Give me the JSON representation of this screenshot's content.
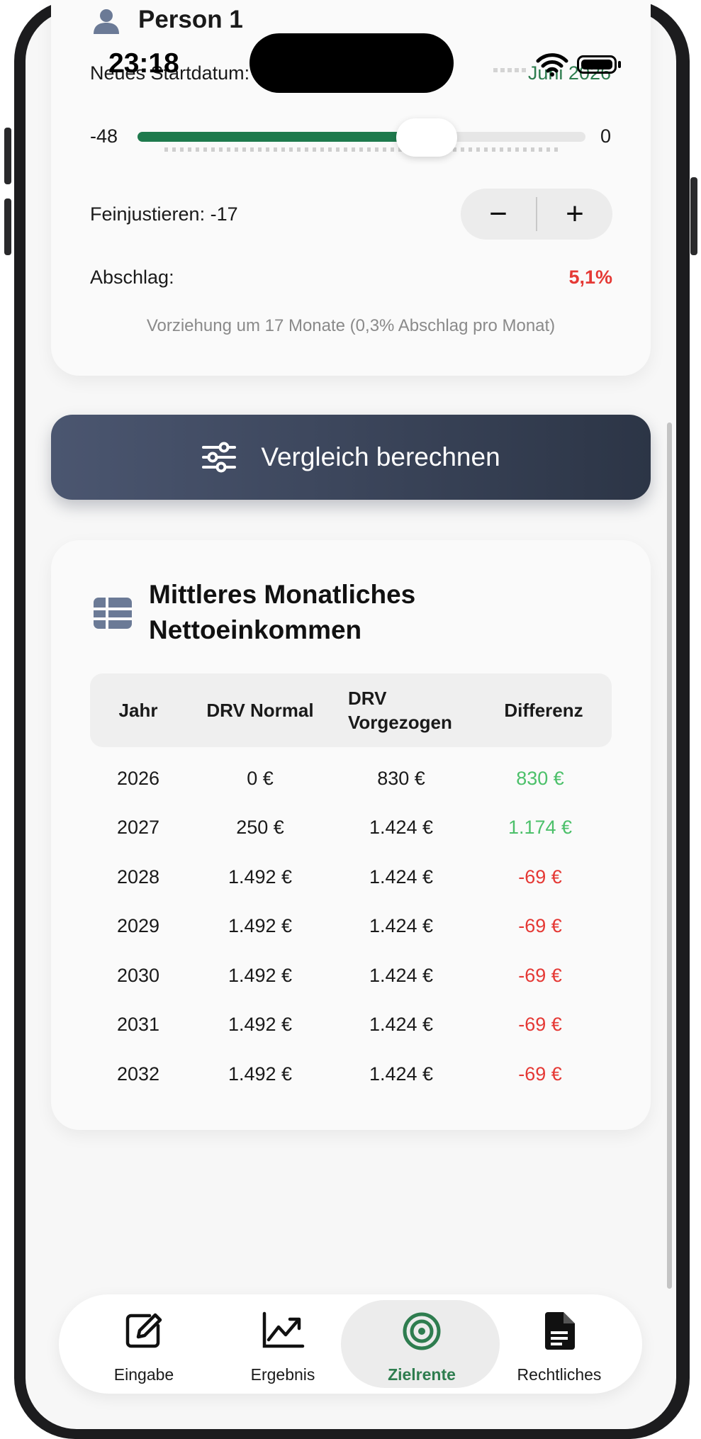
{
  "status_bar": {
    "time": "23:18"
  },
  "person": {
    "name": "Person 1"
  },
  "start_date": {
    "label": "Neues Startdatum:",
    "value": "Juni 2026"
  },
  "slider": {
    "min_label": "-48",
    "max_label": "0",
    "min": -48,
    "max": 0,
    "value": -17
  },
  "fine_tune": {
    "label": "Feinjustieren: -17",
    "minus": "−",
    "plus": "+"
  },
  "discount": {
    "label": "Abschlag:",
    "value": "5,1%"
  },
  "hint": "Vorziehung um 17 Monate (0,3% Abschlag pro Monat)",
  "compare_button": {
    "label": "Vergleich berechnen"
  },
  "table": {
    "title": "Mittleres Monatliches Nettoeinkommen",
    "headers": [
      "Jahr",
      "DRV Normal",
      "DRV Vorgezogen",
      "Differenz"
    ],
    "rows": [
      {
        "year": "2026",
        "normal": "0 €",
        "early": "830 €",
        "diff": "830 €",
        "sign": "pos"
      },
      {
        "year": "2027",
        "normal": "250 €",
        "early": "1.424 €",
        "diff": "1.174 €",
        "sign": "pos"
      },
      {
        "year": "2028",
        "normal": "1.492 €",
        "early": "1.424 €",
        "diff": "-69 €",
        "sign": "neg"
      },
      {
        "year": "2029",
        "normal": "1.492 €",
        "early": "1.424 €",
        "diff": "-69 €",
        "sign": "neg"
      },
      {
        "year": "2030",
        "normal": "1.492 €",
        "early": "1.424 €",
        "diff": "-69 €",
        "sign": "neg"
      },
      {
        "year": "2031",
        "normal": "1.492 €",
        "early": "1.424 €",
        "diff": "-69 €",
        "sign": "neg"
      },
      {
        "year": "2032",
        "normal": "1.492 €",
        "early": "1.424 €",
        "diff": "-69 €",
        "sign": "neg"
      }
    ]
  },
  "tabs": [
    {
      "label": "Eingabe",
      "icon": "edit-icon"
    },
    {
      "label": "Ergebnis",
      "icon": "chart-icon"
    },
    {
      "label": "Zielrente",
      "icon": "target-icon",
      "active": true
    },
    {
      "label": "Rechtliches",
      "icon": "document-icon"
    }
  ],
  "colors": {
    "accent_green": "#2e7d4f",
    "negative_red": "#e53935",
    "positive_green": "#4cc06a",
    "button_dark": "#2c3546"
  }
}
